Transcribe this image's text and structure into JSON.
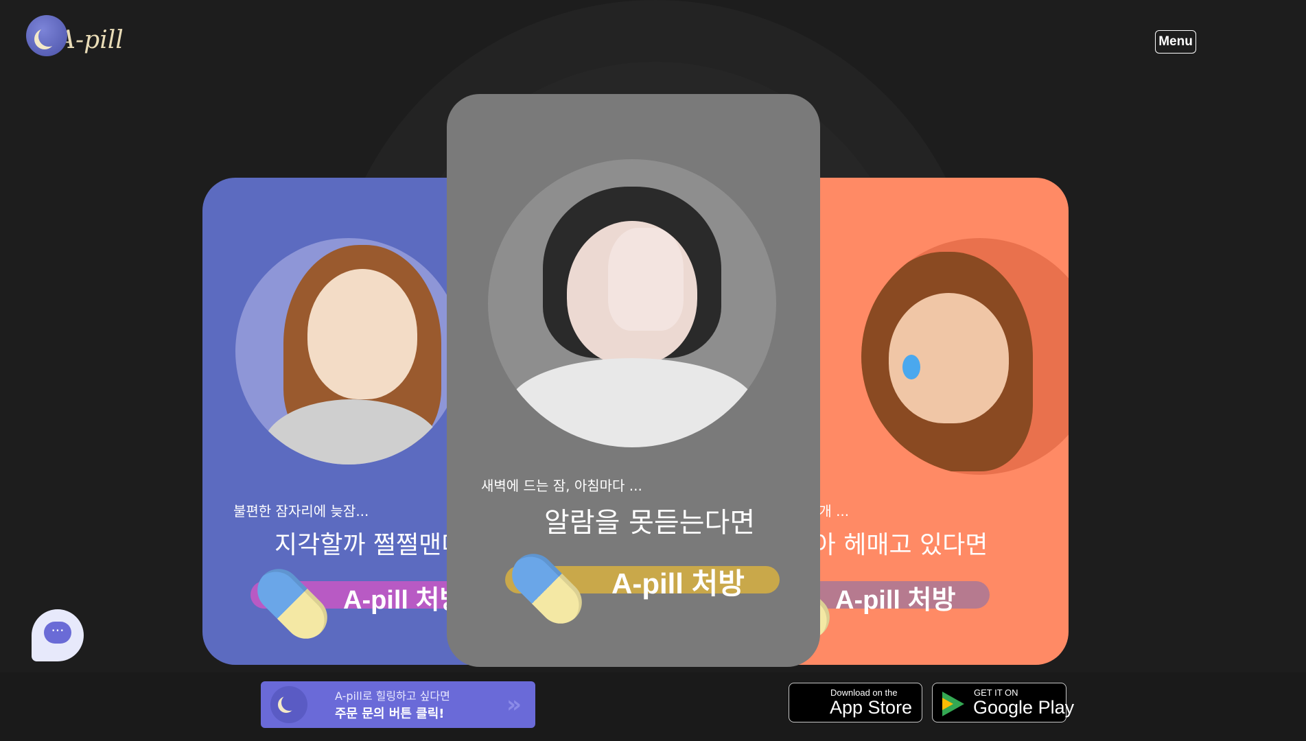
{
  "header": {
    "logo_text": "A-pill",
    "menu_label": "Menu"
  },
  "cards": {
    "left": {
      "sub": "불편한 잠자리에 늦잠...",
      "main": "지각할까 쩔쩔맨다",
      "cta": "A-pill 처방",
      "color": "#5c6bc0"
    },
    "center": {
      "sub": "새벽에 드는 잠, 아침마다 ...",
      "main": "알람을 못듣는다면",
      "cta": "A-pill 처방",
      "color": "#7a7a7a"
    },
    "right": {
      "sub": "게 맞는 베개 ...",
      "main": "도 찾아 헤매고 있다면",
      "cta": "A-pill 처방",
      "color": "#ff8a65"
    }
  },
  "order_button": {
    "line1": "A-pill로 힐링하고 싶다면",
    "line2": "주문 문의 버튼 클릭!",
    "arrow": "»"
  },
  "app_store": {
    "small": "Download on the",
    "big": "App Store"
  },
  "google_play": {
    "small": "GET IT ON",
    "big": "Google Play"
  },
  "chat": {
    "icon_text": "···"
  },
  "colors": {
    "background": "#1d1d1d",
    "accent": "#6a6ad8"
  }
}
